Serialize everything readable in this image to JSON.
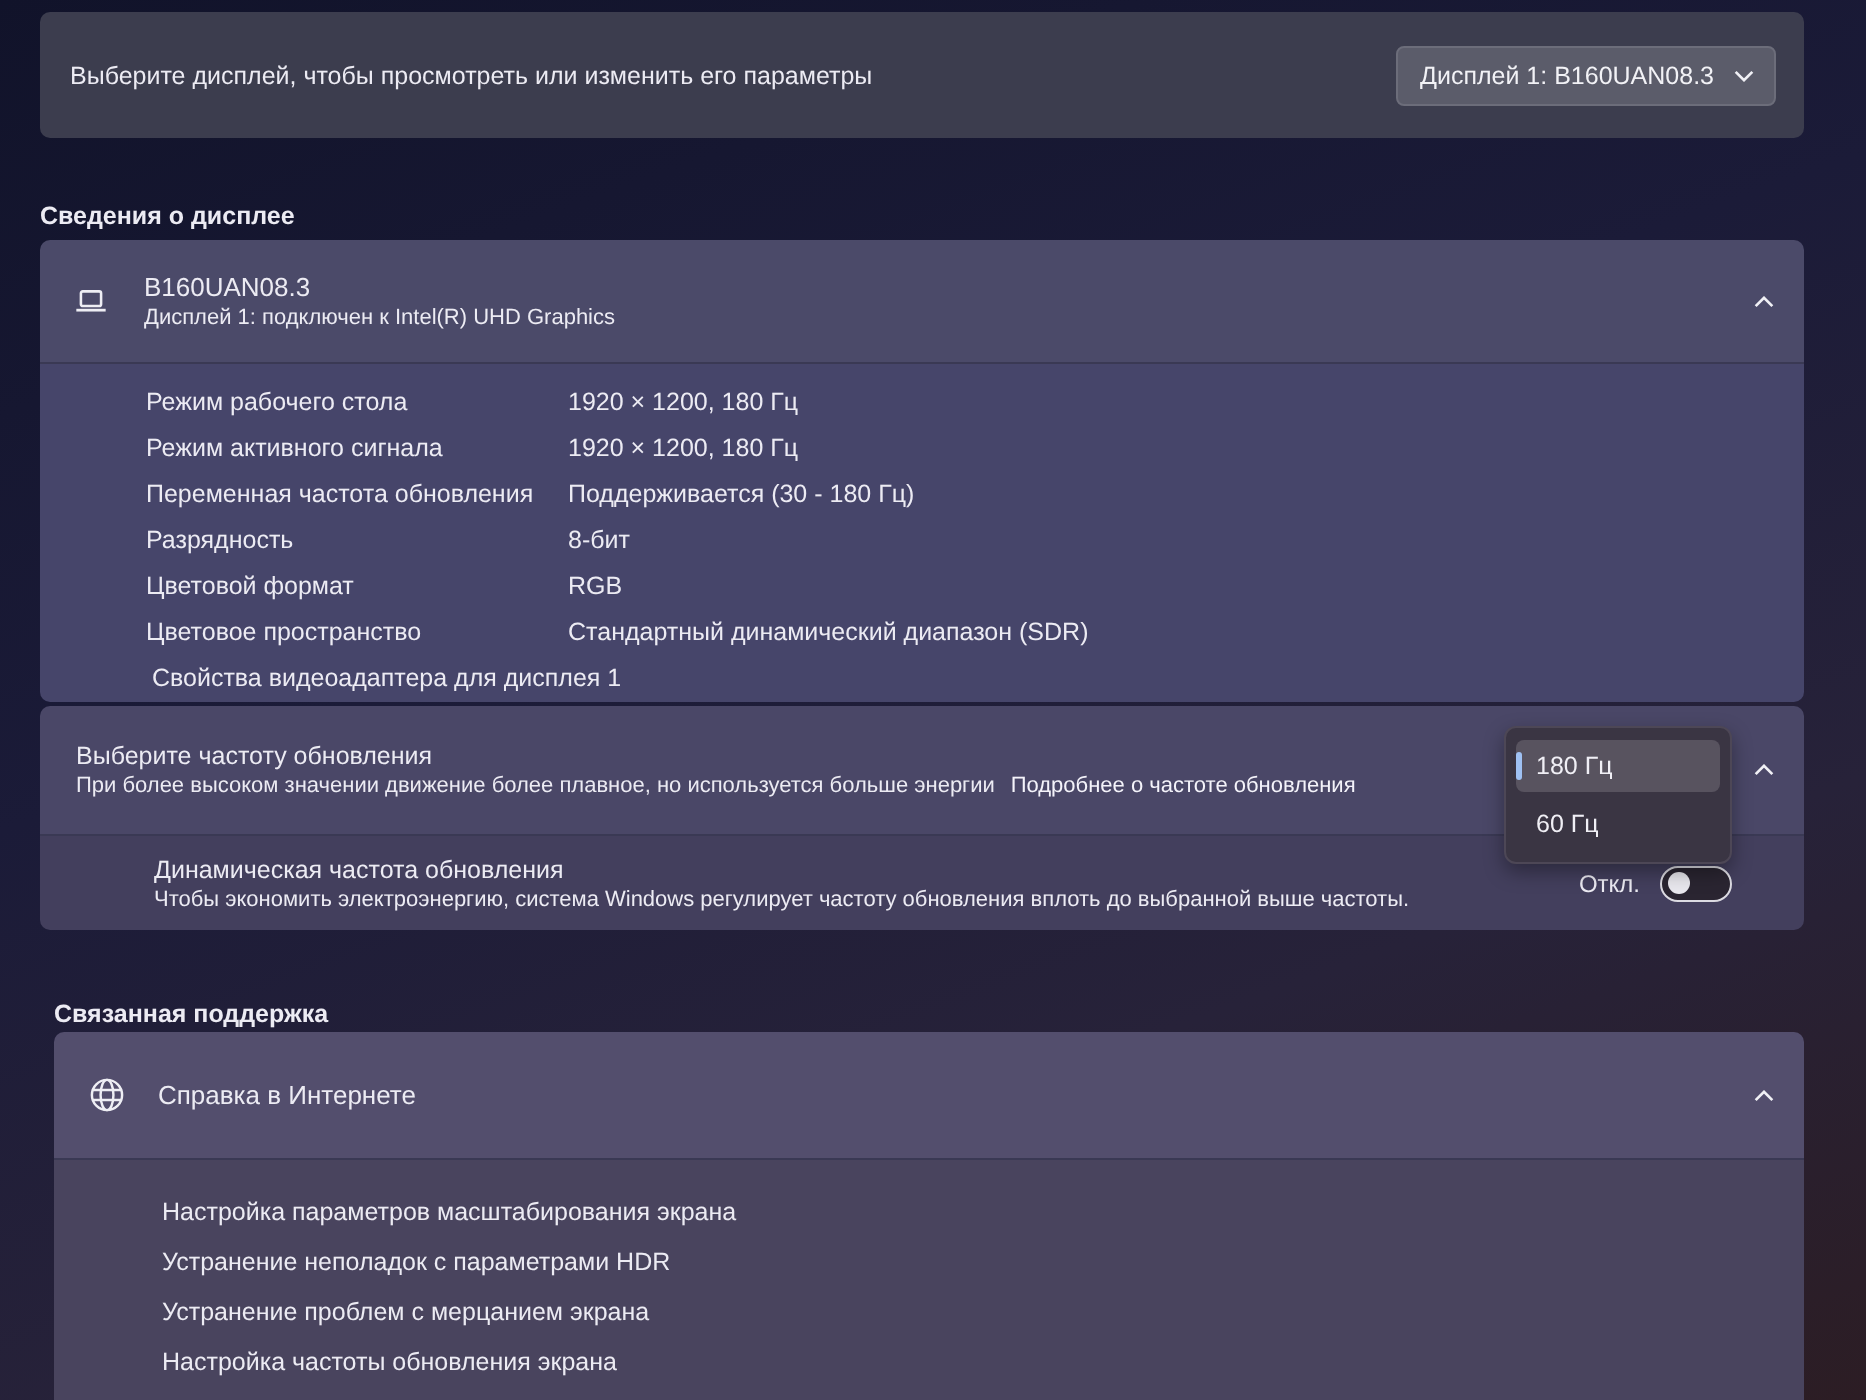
{
  "display_selector": {
    "label": "Выберите дисплей, чтобы просмотреть или изменить его параметры",
    "dropdown": "Дисплей 1: B160UAN08.3"
  },
  "display_info": {
    "heading": "Сведения о дисплее",
    "card": {
      "title": "B160UAN08.3",
      "subtitle": "Дисплей 1: подключен к Intel(R) UHD Graphics",
      "expanded": true,
      "properties": [
        {
          "label": "Режим рабочего стола",
          "value": "1920 × 1200, 180 Гц"
        },
        {
          "label": "Режим активного сигнала",
          "value": "1920 × 1200, 180 Гц"
        },
        {
          "label": "Переменная частота обновления",
          "value": "Поддерживается (30 - 180 Гц)"
        },
        {
          "label": "Разрядность",
          "value": "8-бит"
        },
        {
          "label": "Цветовой формат",
          "value": "RGB"
        },
        {
          "label": "Цветовое пространство",
          "value": "Стандартный динамический диапазон (SDR)"
        }
      ],
      "link": "Свойства видеоадаптера для дисплея 1"
    }
  },
  "refresh_rate": {
    "title": "Выберите частоту обновления",
    "description": "При более высоком значении движение более плавное, но используется больше энергии",
    "link": "Подробнее о частоте обновления",
    "expanded": true,
    "options": [
      {
        "label": "180 Гц",
        "selected": true
      },
      {
        "label": "60 Гц",
        "selected": false
      }
    ],
    "dynamic": {
      "title": "Динамическая частота обновления",
      "description": "Чтобы экономить электроэнергию, система Windows регулирует частоту обновления вплоть до выбранной выше частоты.",
      "state_label": "Откл.",
      "on": false
    }
  },
  "related_support": {
    "heading": "Связанная поддержка",
    "card": {
      "title": "Справка в Интернете",
      "expanded": true,
      "links": [
        "Настройка параметров масштабирования экрана",
        "Устранение неполадок с параметрами HDR",
        "Устранение проблем с мерцанием экрана",
        "Настройка частоты обновления экрана"
      ]
    }
  }
}
